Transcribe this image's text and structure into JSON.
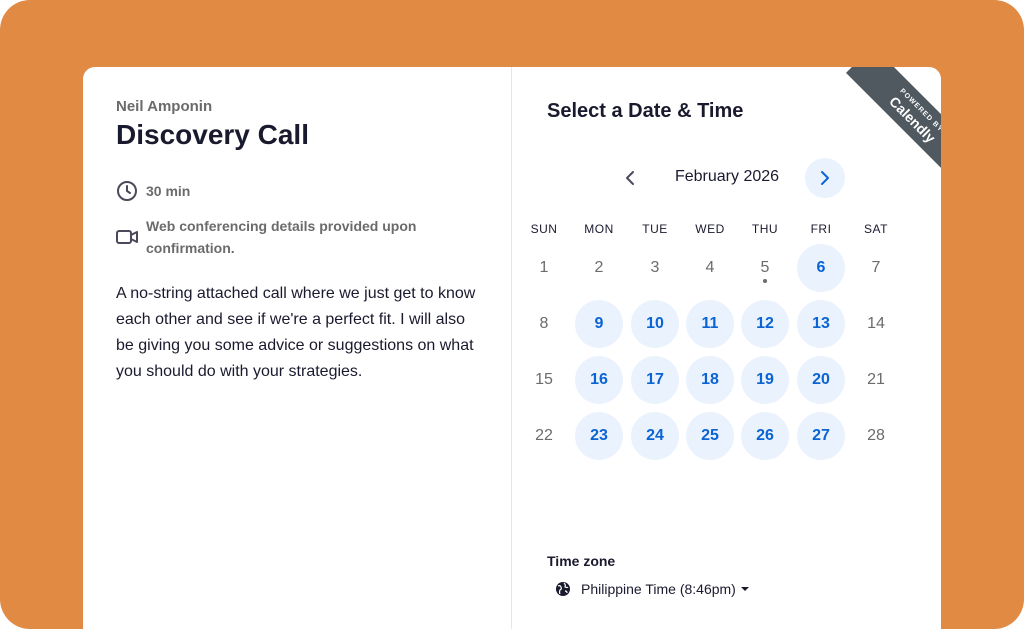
{
  "event": {
    "organizer": "Neil Amponin",
    "title": "Discovery Call",
    "duration": "30 min",
    "conferencing": "Web conferencing details provided upon confirmation.",
    "description": "A no-string attached call where we just get to know each other and see if we're a perfect fit. I will also be giving you some advice or suggestions on what you should do with your strategies."
  },
  "calendar": {
    "heading": "Select a Date & Time",
    "month": "February 2026",
    "weekdays": [
      "SUN",
      "MON",
      "TUE",
      "WED",
      "THU",
      "FRI",
      "SAT"
    ],
    "weeks": [
      [
        {
          "d": "1",
          "a": false
        },
        {
          "d": "2",
          "a": false
        },
        {
          "d": "3",
          "a": false
        },
        {
          "d": "4",
          "a": false
        },
        {
          "d": "5",
          "a": false,
          "today": true
        },
        {
          "d": "6",
          "a": true
        },
        {
          "d": "7",
          "a": false
        }
      ],
      [
        {
          "d": "8",
          "a": false
        },
        {
          "d": "9",
          "a": true
        },
        {
          "d": "10",
          "a": true
        },
        {
          "d": "11",
          "a": true
        },
        {
          "d": "12",
          "a": true
        },
        {
          "d": "13",
          "a": true
        },
        {
          "d": "14",
          "a": false
        }
      ],
      [
        {
          "d": "15",
          "a": false
        },
        {
          "d": "16",
          "a": true
        },
        {
          "d": "17",
          "a": true
        },
        {
          "d": "18",
          "a": true
        },
        {
          "d": "19",
          "a": true
        },
        {
          "d": "20",
          "a": true
        },
        {
          "d": "21",
          "a": false
        }
      ],
      [
        {
          "d": "22",
          "a": false
        },
        {
          "d": "23",
          "a": true
        },
        {
          "d": "24",
          "a": true
        },
        {
          "d": "25",
          "a": true
        },
        {
          "d": "26",
          "a": true
        },
        {
          "d": "27",
          "a": true
        },
        {
          "d": "28",
          "a": false
        }
      ]
    ]
  },
  "timezone": {
    "label": "Time zone",
    "value": "Philippine Time (8:46pm)"
  },
  "badge": {
    "top": "POWERED BY",
    "brand": "Calendly"
  },
  "icons": {
    "duration": "clock-icon",
    "conferencing": "video-camera-icon",
    "prev": "chevron-left-icon",
    "next": "chevron-right-icon",
    "timezone": "globe-icon",
    "dropdown": "caret-down-icon"
  },
  "colors": {
    "background": "#e08a44",
    "accent": "#0b64d3",
    "available_bg": "#eaf2fd",
    "text_dark": "#1a1a2e",
    "text_muted": "#6b6b6b",
    "ribbon": "#505860"
  }
}
